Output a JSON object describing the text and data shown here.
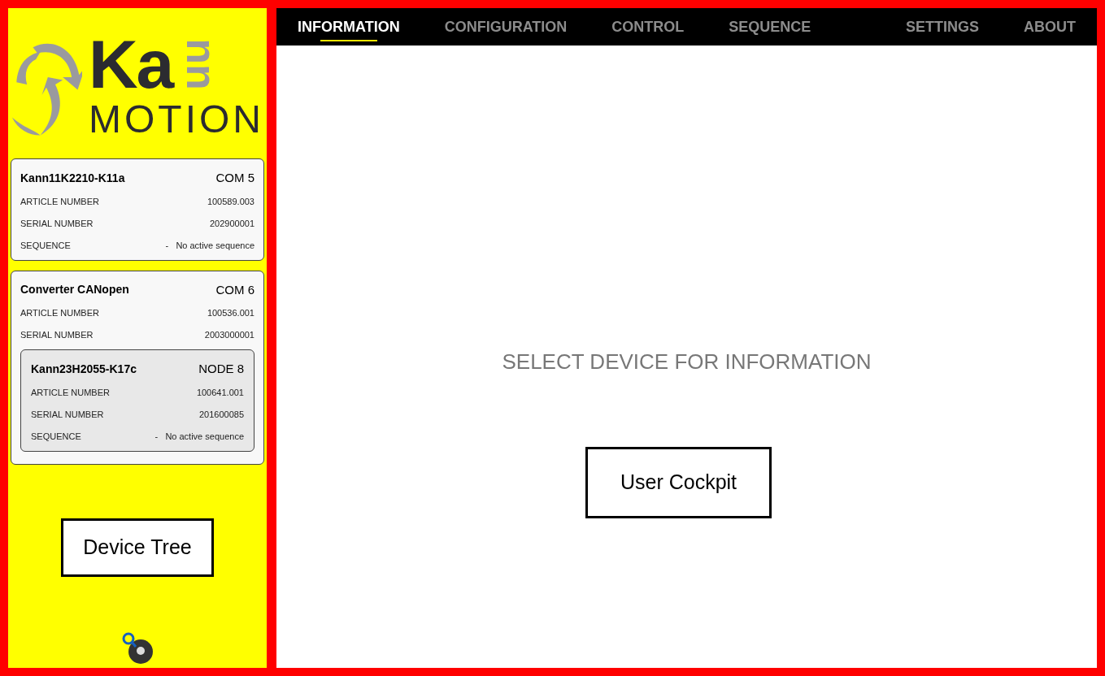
{
  "logo": {
    "main": "Ka",
    "turned": "nn",
    "sub": "MOTION"
  },
  "device_tree": [
    {
      "name": "Kann11K2210-K11a",
      "port": "COM 5",
      "selected": false,
      "fields": [
        {
          "label": "ARTICLE NUMBER",
          "value": "100589.003"
        },
        {
          "label": "SERIAL NUMBER",
          "value": "202900001"
        },
        {
          "label": "SEQUENCE",
          "value": "-   No active sequence"
        }
      ]
    },
    {
      "name": "Converter CANopen",
      "port": "COM 6",
      "selected": false,
      "fields": [
        {
          "label": "ARTICLE NUMBER",
          "value": "100536.001"
        },
        {
          "label": "SERIAL NUMBER",
          "value": "2003000001"
        }
      ],
      "children": [
        {
          "name": "Kann23H2055-K17c",
          "port": "NODE 8",
          "selected": true,
          "fields": [
            {
              "label": "ARTICLE NUMBER",
              "value": "100641.001"
            },
            {
              "label": "SERIAL NUMBER",
              "value": "201600085"
            },
            {
              "label": "SEQUENCE",
              "value": "-   No active sequence"
            }
          ]
        }
      ]
    }
  ],
  "tabs": [
    {
      "label": "INFORMATION",
      "selected": true
    },
    {
      "label": "CONFIGURATION",
      "selected": false
    },
    {
      "label": "CONTROL",
      "selected": false
    },
    {
      "label": "SEQUENCE",
      "selected": false
    },
    {
      "label": "SETTINGS",
      "selected": false
    },
    {
      "label": "ABOUT",
      "selected": false
    }
  ],
  "message": "SELECT DEVICE FOR INFORMATION",
  "annotations": {
    "sidebar": "Device Tree",
    "main": "User Cockpit"
  }
}
